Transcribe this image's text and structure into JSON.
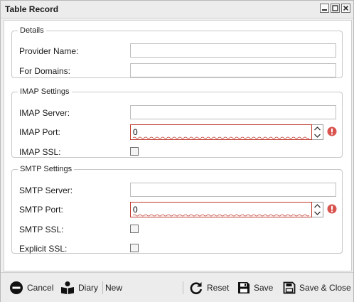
{
  "window": {
    "title": "Table Record"
  },
  "details": {
    "legend": "Details",
    "provider_name_label": "Provider Name:",
    "provider_name_value": "",
    "for_domains_label": "For Domains:",
    "for_domains_value": ""
  },
  "imap": {
    "legend": "IMAP Settings",
    "server_label": "IMAP Server:",
    "server_value": "",
    "port_label": "IMAP Port:",
    "port_value": "0",
    "ssl_label": "IMAP SSL:",
    "ssl_checked": false
  },
  "smtp": {
    "legend": "SMTP Settings",
    "server_label": "SMTP Server:",
    "server_value": "",
    "port_label": "SMTP Port:",
    "port_value": "0",
    "ssl_label": "SMTP SSL:",
    "ssl_checked": false,
    "explicit_ssl_label": "Explicit SSL:",
    "explicit_ssl_checked": false
  },
  "footer": {
    "cancel_label": "Cancel",
    "diary_label": "Diary",
    "status_label": "New",
    "reset_label": "Reset",
    "save_label": "Save",
    "save_close_label": "Save & Close"
  },
  "colors": {
    "error": "#c0392b",
    "invalid_border": "#c0392b"
  }
}
